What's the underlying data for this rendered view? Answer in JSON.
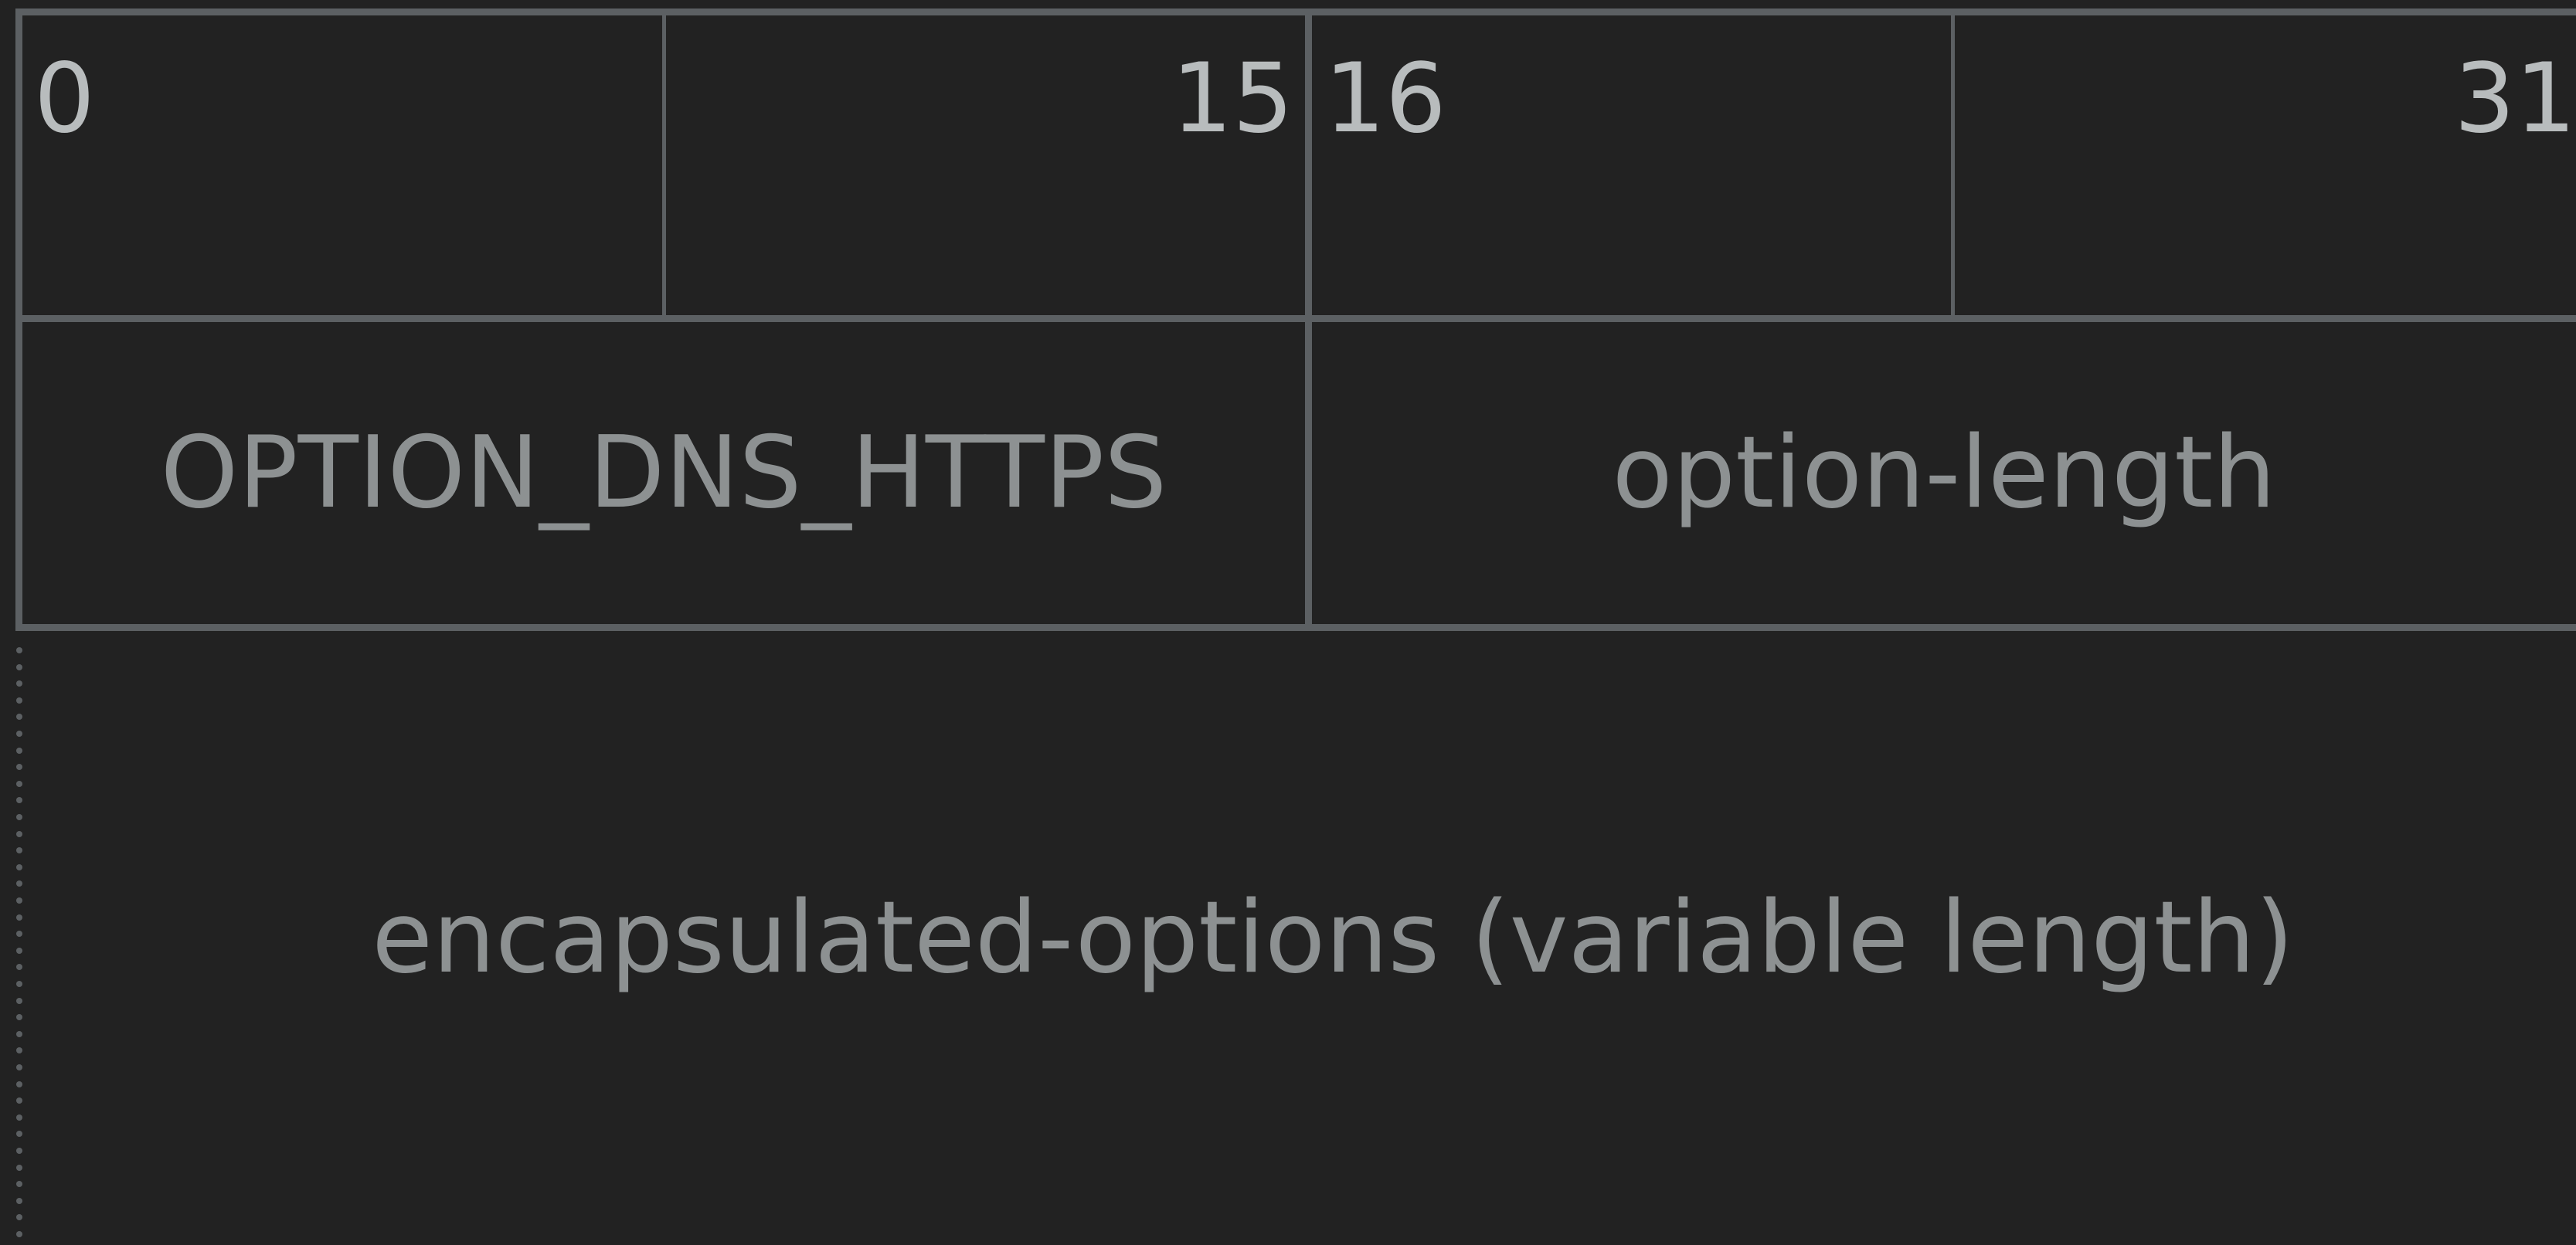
{
  "bit_ruler": {
    "bit_0": "0",
    "bit_15": "15",
    "bit_16": "16",
    "bit_31": "31"
  },
  "fields": {
    "option_code": "OPTION_DNS_HTTPS",
    "option_length": "option-length",
    "encapsulated_options": "encapsulated-options (variable length)"
  },
  "colors": {
    "background": "#222222",
    "border": "#5c6063",
    "bit_label": "#b8bcbd",
    "field_label": "#8d9192"
  }
}
